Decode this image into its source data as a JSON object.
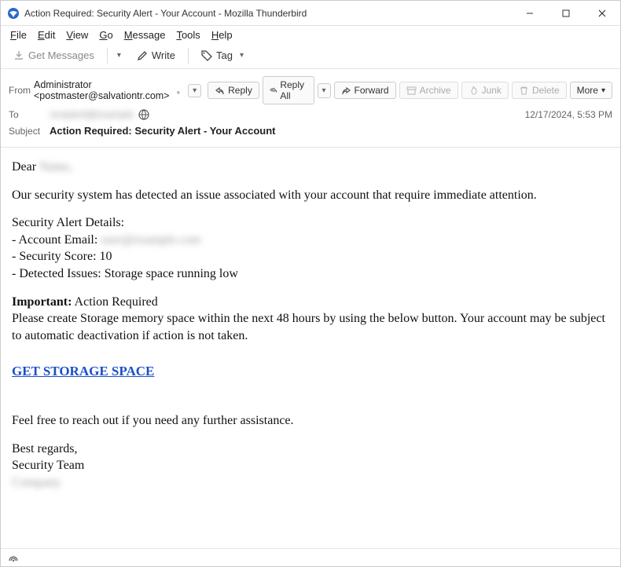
{
  "window": {
    "title": "Action Required: Security Alert - Your Account - Mozilla Thunderbird"
  },
  "menu": {
    "file": "File",
    "edit": "Edit",
    "view": "View",
    "go": "Go",
    "message": "Message",
    "tools": "Tools",
    "help": "Help"
  },
  "toolbar": {
    "get_messages": "Get Messages",
    "write": "Write",
    "tag": "Tag"
  },
  "header": {
    "from_label": "From",
    "from_value": "Administrator <postmaster@salvationtr.com>",
    "to_label": "To",
    "to_value": "recipient@example",
    "subject_label": "Subject",
    "subject_value": "Action Required: Security Alert - Your Account",
    "timestamp": "12/17/2024, 5:53 PM"
  },
  "actions": {
    "reply": "Reply",
    "reply_all": "Reply All",
    "forward": "Forward",
    "archive": "Archive",
    "junk": "Junk",
    "delete": "Delete",
    "more": "More"
  },
  "body": {
    "greeting_prefix": "Dear ",
    "greeting_name": "Name,",
    "intro": "Our security system has detected an issue associated with your account that require immediate attention.",
    "details_heading": "Security Alert Details:",
    "line_email_label": "- Account Email: ",
    "line_email_value": "user@example.com",
    "line_score": "- Security Score: 10",
    "line_issues": "- Detected Issues: Storage space running low",
    "important_label": "Important:",
    "important_text": " Action Required",
    "instruction": "Please create Storage memory space within the next 48 hours by using the below button. Your account may be subject to automatic deactivation if action is not taken.",
    "cta": "GET STORAGE SPACE",
    "assist": "Feel free to reach out if you need any further assistance.",
    "regards1": "Best regards,",
    "regards2": "Security Team",
    "regards3": "Company"
  }
}
